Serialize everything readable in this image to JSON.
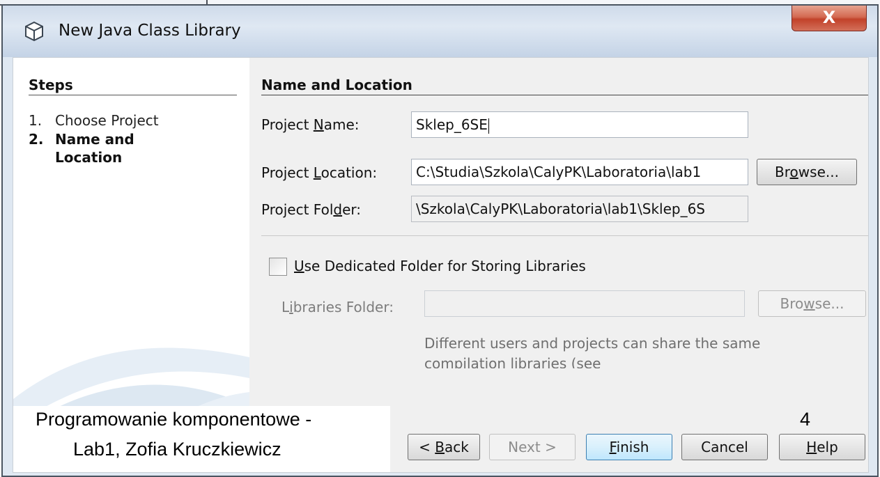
{
  "window": {
    "title": "New Java Class Library",
    "close_glyph": "X"
  },
  "steps": {
    "heading": "Steps",
    "items": [
      {
        "number": "1.",
        "label": "Choose Project"
      },
      {
        "number": "2.",
        "label_line1": "Name and",
        "label_line2": "Location"
      }
    ]
  },
  "main": {
    "heading": "Name and Location",
    "project_name": {
      "label_pre": "Project ",
      "label_u": "N",
      "label_post": "ame:",
      "value": "Sklep_6SE"
    },
    "project_location": {
      "label_pre": "Project ",
      "label_u": "L",
      "label_post": "ocation:",
      "value": "C:\\Studia\\Szkola\\CalyPK\\Laboratoria\\lab1"
    },
    "browse": {
      "pre": "Br",
      "u": "o",
      "post": "wse..."
    },
    "project_folder": {
      "label_pre": "Project Fol",
      "label_u": "d",
      "label_post": "er:",
      "value": "\\Szkola\\CalyPK\\Laboratoria\\lab1\\Sklep_6S"
    },
    "dedicated_folder": {
      "u": "U",
      "post": "se Dedicated Folder for Storing Libraries",
      "checked": false
    },
    "libraries_folder": {
      "label_pre": "L",
      "label_u": "i",
      "label_post": "braries Folder:",
      "value": ""
    },
    "browse2": {
      "pre": "Bro",
      "u": "w",
      "post": "se..."
    },
    "help_text": "Different users and projects can share the same compilation libraries (see"
  },
  "buttons": {
    "back": {
      "pre": "< ",
      "u": "B",
      "post": "ack"
    },
    "next": "Next >",
    "finish": {
      "u": "F",
      "post": "inish"
    },
    "cancel": "Cancel",
    "help": {
      "u": "H",
      "post": "elp"
    }
  },
  "footer": {
    "line1": "Programowanie komponentowe -",
    "line2": "Lab1, Zofia Kruczkiewicz",
    "page_number": "4"
  },
  "colors": {
    "titlebar": "#dfe8f3",
    "close_button": "#c2422a",
    "panel": "#f0f0f0",
    "default_button": "#bee6fd"
  }
}
